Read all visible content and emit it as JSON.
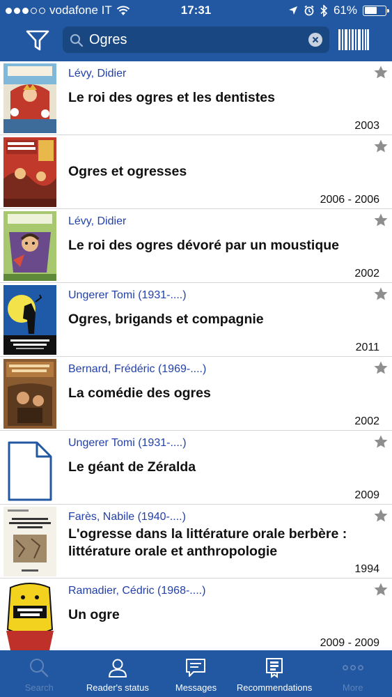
{
  "status_bar": {
    "carrier": "vodafone IT",
    "time": "17:31",
    "battery": "61%",
    "battery_level": 0.61
  },
  "search": {
    "query": "Ogres"
  },
  "results": [
    {
      "author": "Lévy, Didier",
      "title": "Le roi des ogres et les dentistes",
      "date": "2003"
    },
    {
      "author": "",
      "title": "Ogres et ogresses",
      "date": "2006 - 2006"
    },
    {
      "author": "Lévy, Didier",
      "title": "Le roi des ogres dévoré par un moustique",
      "date": "2002"
    },
    {
      "author": "Ungerer Tomi (1931-....)",
      "title": "Ogres, brigands et compagnie",
      "date": "2011"
    },
    {
      "author": "Bernard, Frédéric (1969-....)",
      "title": "La comédie des ogres",
      "date": "2002"
    },
    {
      "author": "Ungerer Tomi (1931-....)",
      "title": "Le géant de Zéralda",
      "date": "2009"
    },
    {
      "author": "Farès, Nabile (1940-....)",
      "title": "L'ogresse dans la littérature orale berbère : littérature orale et anthropologie",
      "date": "1994"
    },
    {
      "author": "Ramadier, Cédric (1968-....)",
      "title": "Un ogre",
      "date": "2009 - 2009"
    }
  ],
  "tabbar": {
    "items": [
      {
        "label": "Search",
        "icon": "search-icon"
      },
      {
        "label": "Reader's status",
        "icon": "user-icon"
      },
      {
        "label": "Messages",
        "icon": "message-icon"
      },
      {
        "label": "Recommendations",
        "icon": "recommendations-icon"
      },
      {
        "label": "More",
        "icon": "more-icon"
      }
    ]
  },
  "colors": {
    "brand": "#2257a1",
    "search_field": "#194782",
    "author": "#2240a8",
    "star": "#8e8e8e"
  }
}
